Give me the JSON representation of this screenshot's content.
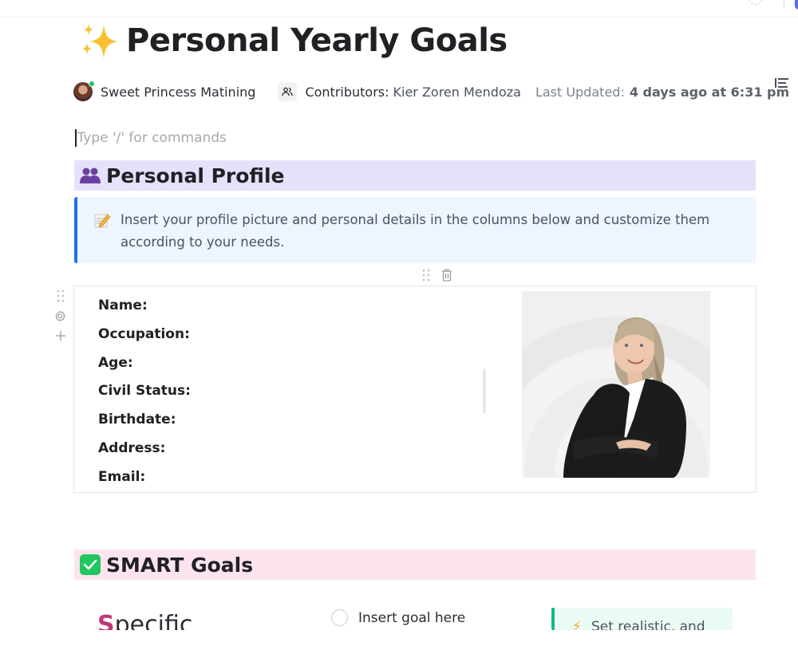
{
  "page": {
    "title": "Personal Yearly Goals",
    "title_icon": "sparkles-icon"
  },
  "meta": {
    "author": "Sweet Princess Matining",
    "author_status": "online",
    "contributors_label": "Contributors:",
    "contributors": "Kier Zoren Mendoza",
    "last_updated_label": "Last Updated:",
    "last_updated_value": "4 days ago at 6:31 pm"
  },
  "editor": {
    "command_placeholder": "Type '/' for commands"
  },
  "sections": {
    "profile": {
      "heading": "Personal Profile",
      "icon": "people-icon",
      "callout_icon": "memo-icon",
      "callout_text": "Insert your profile picture and personal details in the columns below and customize them according to your needs.",
      "fields": [
        "Name:",
        "Occupation:",
        "Age:",
        "Civil Status:",
        "Birthdate:",
        "Address:",
        "Email:"
      ],
      "photo": "profile-photo"
    },
    "smart": {
      "heading": "SMART Goals",
      "icon": "check-box-icon",
      "specific_first_letter": "S",
      "specific_rest": "pecific",
      "goal_placeholder": "Insert goal here",
      "tip_icon": "lightning-icon",
      "tip_text": "Set realistic, and"
    }
  },
  "colors": {
    "profile_heading_bg": "#e4e2fb",
    "smart_heading_bg": "#fce4ef",
    "callout_bg": "#eef5fe",
    "callout_border": "#1f6ff0",
    "tip_bg": "#e9fbf3",
    "tip_border": "#10b981",
    "specific_accent": "#c0377a"
  }
}
